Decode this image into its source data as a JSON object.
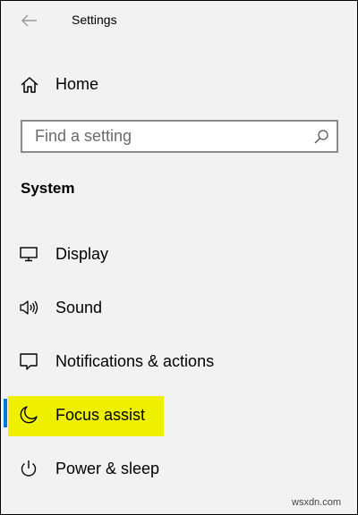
{
  "window": {
    "title": "Settings"
  },
  "home": {
    "label": "Home",
    "icon": "home-icon"
  },
  "search": {
    "placeholder": "Find a setting",
    "value": "",
    "icon": "search-icon"
  },
  "section": {
    "heading": "System"
  },
  "nav": {
    "items": [
      {
        "label": "Display",
        "icon": "monitor-icon",
        "selected": false
      },
      {
        "label": "Sound",
        "icon": "speaker-icon",
        "selected": false
      },
      {
        "label": "Notifications & actions",
        "icon": "notification-icon",
        "selected": false
      },
      {
        "label": "Focus assist",
        "icon": "moon-icon",
        "selected": true
      },
      {
        "label": "Power & sleep",
        "icon": "power-icon",
        "selected": false
      }
    ]
  },
  "colors": {
    "background": "#f2f2f2",
    "accent": "#0078d7",
    "highlight": "#eef000"
  },
  "watermark": "wsxdn.com"
}
